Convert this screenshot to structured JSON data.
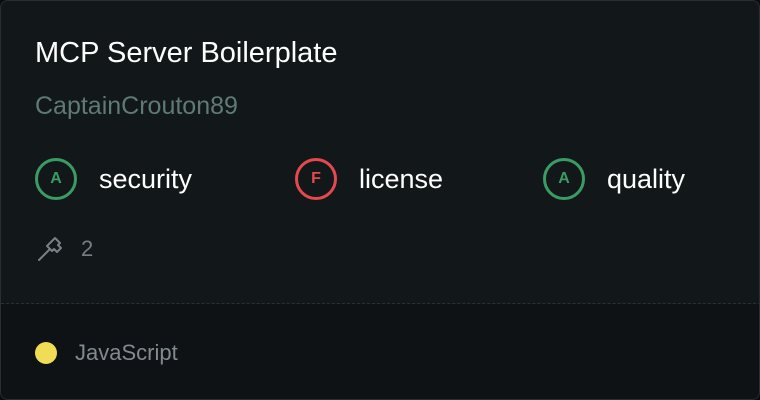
{
  "card": {
    "title": "MCP Server Boilerplate",
    "owner": "CaptainCrouton89"
  },
  "scores": [
    {
      "grade": "A",
      "label": "security",
      "color": "#3a9b63"
    },
    {
      "grade": "F",
      "label": "license",
      "color": "#e5484d"
    },
    {
      "grade": "A",
      "label": "quality",
      "color": "#3a9b63"
    }
  ],
  "tools": {
    "icon": "hammer-icon",
    "count": "2"
  },
  "footer": {
    "language": "JavaScript",
    "language_color": "#f0dc55"
  }
}
